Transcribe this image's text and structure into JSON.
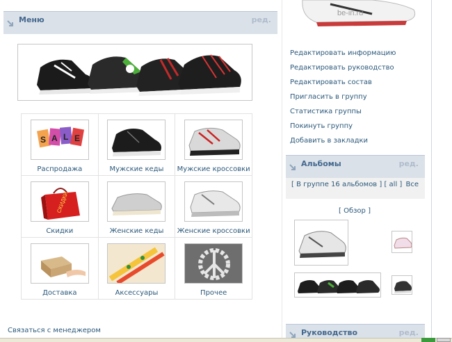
{
  "menu": {
    "title": "Меню",
    "edit": "ред."
  },
  "tiles": [
    {
      "label": "Распродажа",
      "icon": "sale-tags-icon"
    },
    {
      "label": "Мужские кеды",
      "icon": "mens-sneaker-icon"
    },
    {
      "label": "Мужские кроссовки",
      "icon": "mens-running-shoe-icon"
    },
    {
      "label": "Скидки",
      "icon": "discount-bag-icon"
    },
    {
      "label": "Женские кеды",
      "icon": "womens-sneaker-icon"
    },
    {
      "label": "Женские кроссовки",
      "icon": "womens-running-shoe-icon"
    },
    {
      "label": "Доставка",
      "icon": "delivery-box-icon"
    },
    {
      "label": "Аксессуары",
      "icon": "laces-accessories-icon"
    },
    {
      "label": "Прочее",
      "icon": "misc-shoes-icon"
    }
  ],
  "contact": "Связаться с менеджером",
  "watermark": "be-in.ru",
  "sale_letters": [
    "S",
    "A",
    "L",
    "E"
  ],
  "discount_text": "СКИДКИ",
  "actions": [
    "Редактировать информацию",
    "Редактировать руководство",
    "Редактировать состав",
    "Пригласить в группу",
    "Статистика группы",
    "Покинуть группу",
    "Добавить в закладки"
  ],
  "albums": {
    "title": "Альбомы",
    "edit": "ред.",
    "info": "[ В группе 16 альбомов ] [ all ]",
    "all": "Все",
    "overview": "[ Обзор ]"
  },
  "lead": {
    "title": "Руководство",
    "edit": "ред."
  },
  "colors": {
    "link": "#2b587a",
    "header_bg": "#dae1e8",
    "header_title": "#45688e"
  }
}
